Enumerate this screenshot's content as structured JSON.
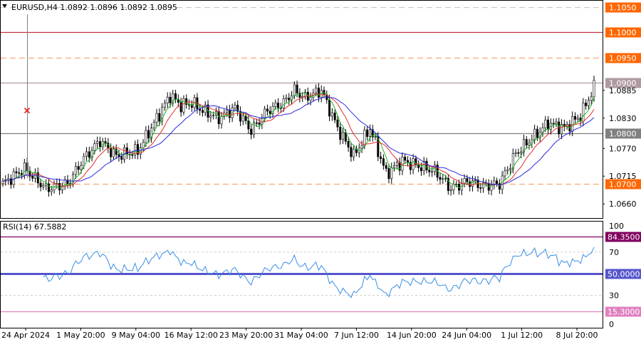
{
  "instrument": {
    "symbol_title": "EURUSD,H4  1.0892 1.0896 1.0892 1.0895",
    "menu_icon": "triangle-down-icon"
  },
  "rsi_panel": {
    "title": "RSI(14) 67.5882"
  },
  "chart_data": [
    {
      "type": "candlestick",
      "title": "EURUSD,H4  1.0892 1.0896 1.0892 1.0895",
      "price_ticks": [
        "1.0885",
        "1.0830",
        "1.0770",
        "1.0715",
        "1.0660"
      ],
      "x_ticks": [
        "24 Apr 2024",
        "1 May 20:00",
        "9 May 04:00",
        "16 May 12:00",
        "23 May 20:00",
        "31 May 04:00",
        "7 Jun 12:00",
        "14 Jun 20:00",
        "24 Jun 04:00",
        "1 Jul 12:00",
        "8 Jul 20:00"
      ],
      "ylim": [
        1.0632,
        1.1064
      ],
      "levels": [
        {
          "label": "1.1050",
          "value": 1.105,
          "style": "dashed",
          "line_color": "#cccccc",
          "tag_color": "#ff6600"
        },
        {
          "label": "1.1000",
          "value": 1.1,
          "style": "solid",
          "line_color": "#c03040",
          "tag_color": "#ff6600"
        },
        {
          "label": "1.0950",
          "value": 1.095,
          "style": "dashed",
          "line_color": "#f5a87a",
          "tag_color": "#ff6600"
        },
        {
          "label": "1.0900",
          "value": 1.09,
          "style": "solid",
          "line_color": "#b09aa0",
          "tag_color": "#b09aa0"
        },
        {
          "label": "1.0800",
          "value": 1.08,
          "style": "solid",
          "line_color": "#808080",
          "tag_color": "#808080"
        },
        {
          "label": "1.0700",
          "value": 1.07,
          "style": "dashed",
          "line_color": "#f5a87a",
          "tag_color": "#ff6600"
        }
      ],
      "trend_anchors": {
        "x": [
          0,
          8,
          16,
          24,
          30,
          36,
          42,
          50,
          56,
          62,
          66,
          70,
          74,
          80,
          86,
          92,
          98,
          104,
          108,
          112,
          118,
          124,
          130,
          136,
          142,
          148,
          154,
          160,
          166,
          172,
          178,
          184,
          190,
          196,
          202,
          208,
          214,
          219
        ],
        "price": [
          1.07,
          1.073,
          1.069,
          1.07,
          1.075,
          1.0785,
          1.0755,
          1.0765,
          1.082,
          1.0875,
          1.0855,
          1.086,
          1.0845,
          1.083,
          1.085,
          1.0805,
          1.0845,
          1.086,
          1.0885,
          1.087,
          1.0885,
          1.081,
          1.0755,
          1.081,
          1.072,
          1.0745,
          1.0735,
          1.0725,
          1.069,
          1.0705,
          1.0695,
          1.07,
          1.076,
          1.079,
          1.082,
          1.081,
          1.0835,
          1.089
        ]
      },
      "moving_averages": [
        {
          "period": 5,
          "color": "#22b522"
        },
        {
          "period": 10,
          "color": "#e0302a"
        },
        {
          "period": 20,
          "color": "#2a2ae0"
        }
      ],
      "annotation": {
        "marker": "x",
        "color": "#e02020",
        "value": 1.0845
      }
    },
    {
      "type": "line",
      "title": "RSI(14) 67.5882",
      "current_value": 67.5882,
      "ylim": [
        15.3,
        84.35
      ],
      "ticks": [
        "100",
        "70",
        "30",
        "0"
      ],
      "levels": [
        {
          "label": "84.3500",
          "value": 84.35,
          "line_color": "#800060",
          "tag_color": "#800060",
          "width": 1.2
        },
        {
          "label": "50.0000",
          "value": 50.0,
          "line_color": "#5555cc",
          "tag_color": "#5555cc",
          "width": 3
        },
        {
          "label": "15.3000",
          "value": 15.3,
          "line_color": "#e080c0",
          "tag_color": "#e080c0",
          "width": 1.2
        }
      ],
      "guide_levels": [
        70,
        30
      ],
      "series_color": "#3a8ee6"
    }
  ]
}
